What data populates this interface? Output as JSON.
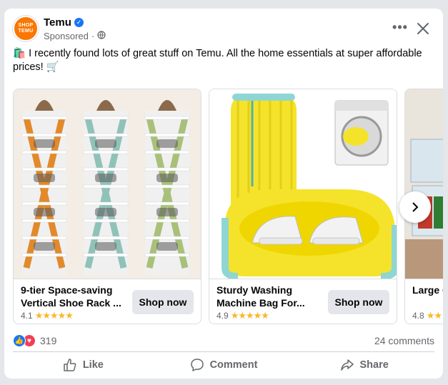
{
  "post": {
    "page_name": "Temu",
    "avatar_text_top": "SHOP",
    "avatar_text_bottom": "TEMU",
    "sponsored": "Sponsored",
    "separator": "·",
    "text": "🛍️ I recently found lots of great stuff on Temu. All the home essentials at super affordable prices! 🛒"
  },
  "carousel": {
    "items": [
      {
        "title": "9-tier Space-saving Vertical Shoe Rack ...",
        "rating": "4.1",
        "stars": "★★★★★",
        "button": "Shop now"
      },
      {
        "title": "Sturdy Washing Machine Bag For...",
        "rating": "4.9",
        "stars": "★★★★★",
        "button": "Shop now"
      },
      {
        "title": "Large Ca Transpar",
        "rating": "4.8",
        "stars": "★★",
        "button": ""
      }
    ],
    "next_icon": "chevron-right-icon"
  },
  "footer": {
    "reaction_count": "319",
    "comments": "24 comments",
    "like": "Like",
    "comment": "Comment",
    "share": "Share"
  },
  "colors": {
    "brand": "#fb7701",
    "facebook_blue": "#1877f2",
    "star": "#f7b928"
  }
}
